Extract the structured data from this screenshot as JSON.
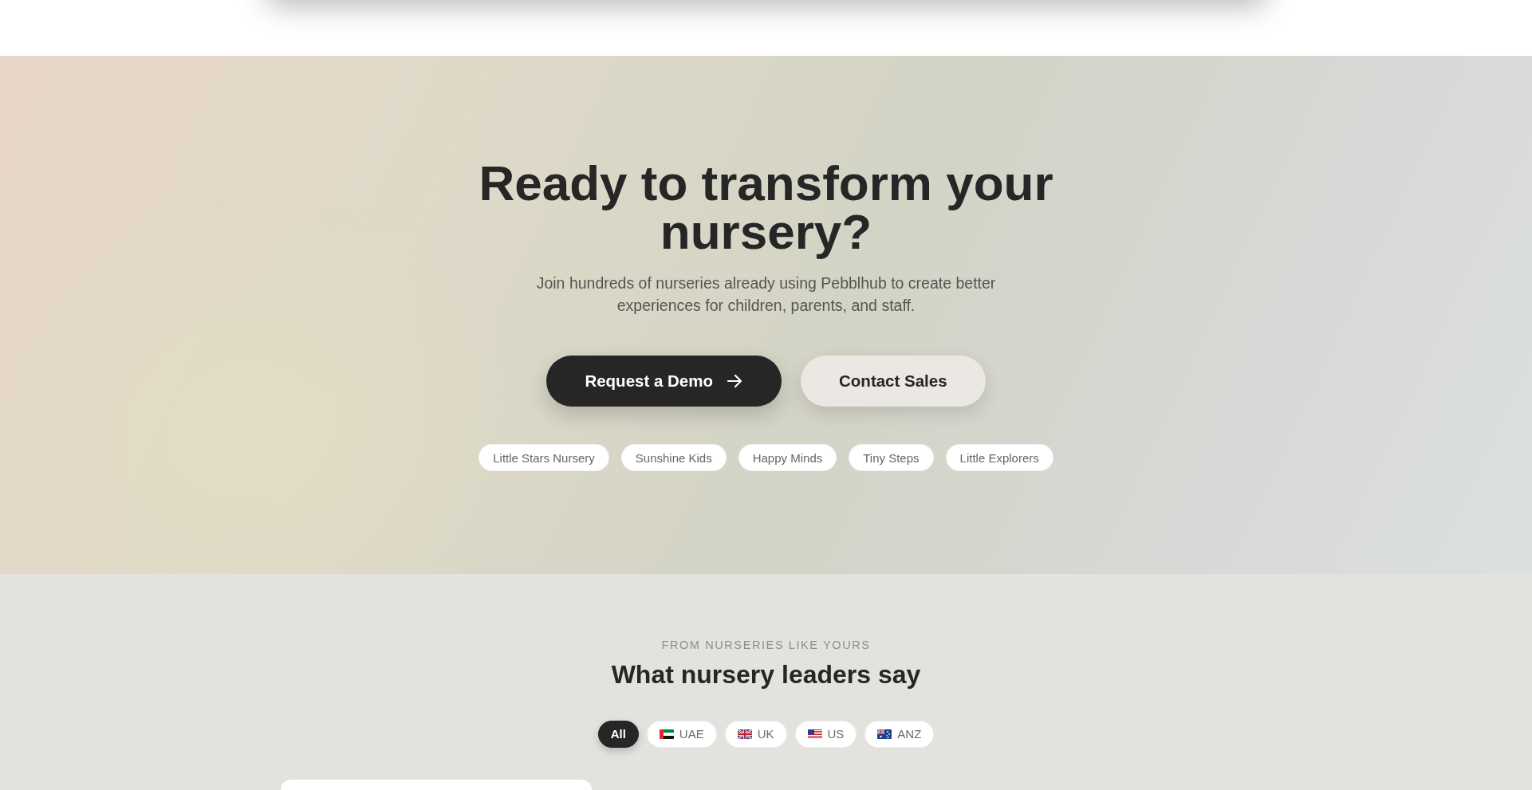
{
  "hero": {
    "title": "Ready to transform your nursery?",
    "subtitle": "Join hundreds of nurseries already using Pebblhub to create better experiences for children, parents, and staff.",
    "buttons": [
      {
        "label": "Request a Demo",
        "kind": "primary"
      },
      {
        "label": "Contact Sales",
        "kind": "secondary"
      }
    ],
    "nurseries": [
      "Little Stars Nursery",
      "Sunshine Kids",
      "Happy Minds",
      "Tiny Steps",
      "Little Explorers"
    ]
  },
  "testimonials": {
    "eyebrow": "FROM NURSERIES LIKE YOURS",
    "title": "What nursery leaders say",
    "filters": [
      {
        "label": "All",
        "selected": true
      },
      {
        "label": "UAE",
        "selected": false
      },
      {
        "label": "UK",
        "selected": false
      },
      {
        "label": "US",
        "selected": false
      },
      {
        "label": "ANZ",
        "selected": false
      }
    ]
  }
}
